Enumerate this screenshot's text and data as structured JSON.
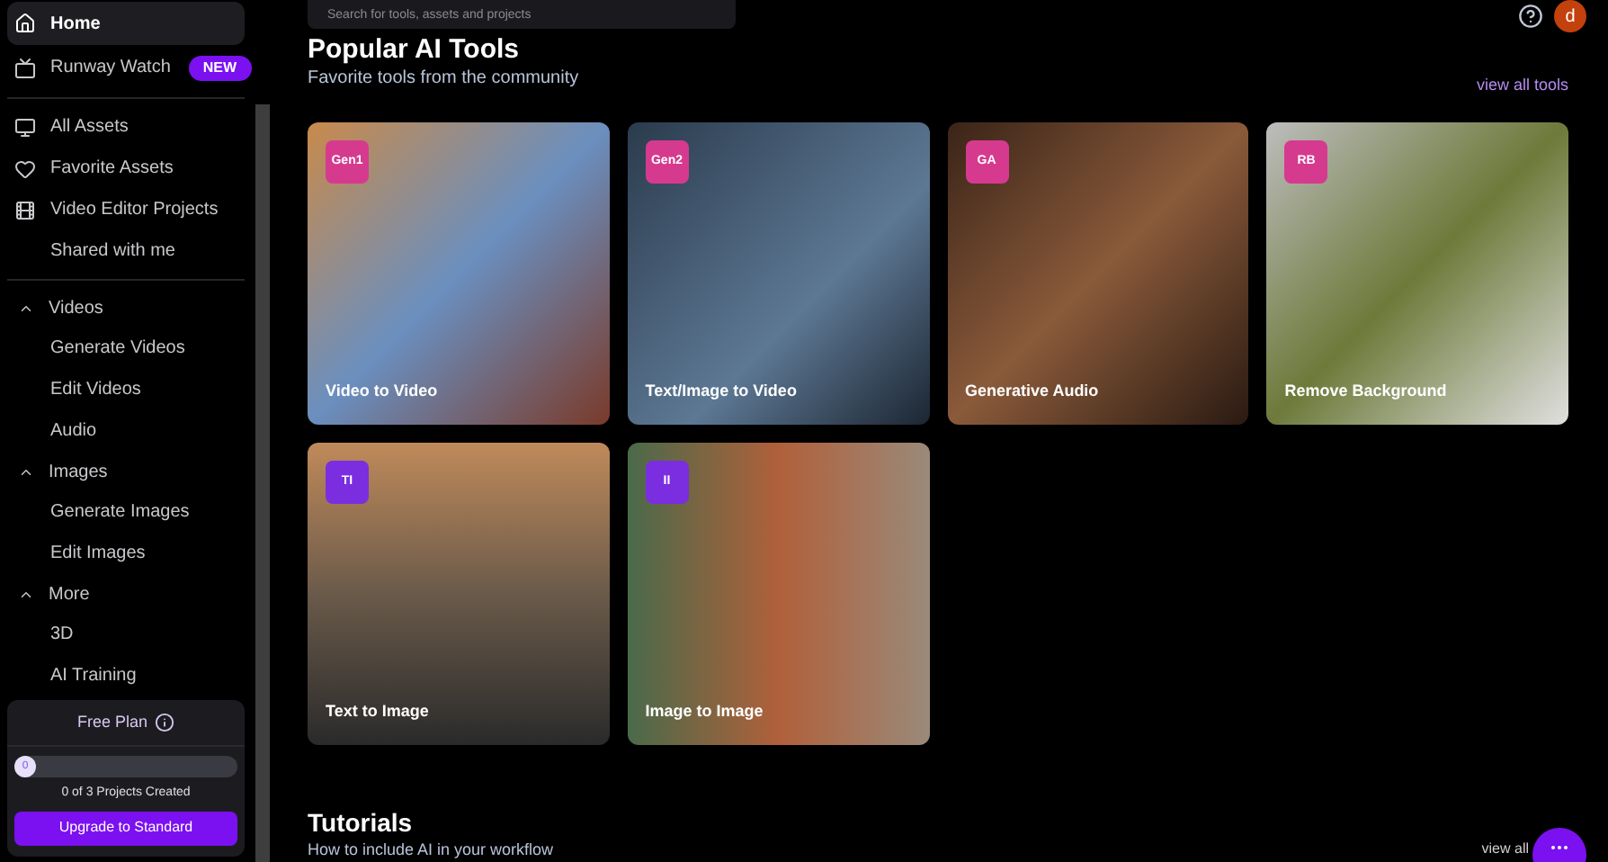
{
  "sidebar": {
    "top_items": [
      {
        "label": "Home",
        "selected": true
      },
      {
        "label": "Runway Watch",
        "selected": false,
        "badge": "NEW"
      }
    ],
    "asset_items": [
      {
        "label": "All Assets",
        "selected": false
      },
      {
        "label": "Favorite Assets",
        "selected": false
      },
      {
        "label": "Video Editor Projects",
        "selected": false
      },
      {
        "label": "Shared with me",
        "selected": false
      }
    ],
    "sections": [
      {
        "label": "Videos",
        "expanded": true,
        "children": [
          {
            "label": "Generate Videos",
            "selected": false
          },
          {
            "label": "Edit Videos",
            "selected": false
          },
          {
            "label": "Audio",
            "selected": false
          }
        ]
      },
      {
        "label": "Images",
        "expanded": true,
        "children": [
          {
            "label": "Generate Images",
            "selected": false
          },
          {
            "label": "Edit Images",
            "selected": false
          }
        ]
      },
      {
        "label": "More",
        "expanded": true,
        "children": [
          {
            "label": "3D",
            "selected": false
          },
          {
            "label": "AI Training",
            "selected": false
          }
        ]
      }
    ],
    "plan": {
      "title": "Free Plan",
      "level": 0.0,
      "count": "0",
      "caption": "0 of 3 Projects Created",
      "button": "Upgrade to Standard"
    }
  },
  "header": {
    "search": {
      "placeholder": "Search for tools, assets and projects"
    },
    "avatar": "d"
  },
  "popular": {
    "title": "Popular AI Tools",
    "subtitle": "Favorite tools from the community",
    "link": "view all tools",
    "tools": [
      {
        "badge": "Gen1",
        "label": "Video to Video",
        "color": "#d63a8f"
      },
      {
        "badge": "Gen2",
        "label": "Text/Image to Video",
        "color": "#d63a8f"
      },
      {
        "badge": "GA",
        "label": "Generative Audio",
        "color": "#d63a8f"
      },
      {
        "badge": "RB",
        "label": "Remove Background",
        "color": "#d63a8f"
      },
      {
        "badge": "TI",
        "label": "Text to Image",
        "color": "#7b2ee0"
      },
      {
        "badge": "II",
        "label": "Image to Image",
        "color": "#7b2ee0"
      }
    ]
  },
  "tutorials": {
    "title": "Tutorials",
    "subtitle": "How to include AI in your workflow",
    "link": "view all"
  }
}
